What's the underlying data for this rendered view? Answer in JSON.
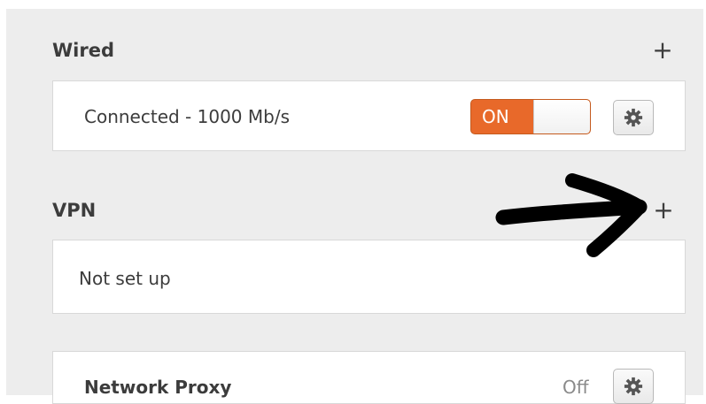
{
  "wired": {
    "title": "Wired",
    "add_symbol": "+",
    "status": "Connected - 1000 Mb/s",
    "toggle_label": "ON",
    "toggle_state": "on"
  },
  "vpn": {
    "title": "VPN",
    "add_symbol": "+",
    "status": "Not set up"
  },
  "proxy": {
    "title": "Network Proxy",
    "status": "Off"
  },
  "colors": {
    "toggle_accent": "#e8692a",
    "panel_background": "#ededed",
    "annotation_arrow": "#000000"
  },
  "icons": {
    "settings": "gear-icon",
    "add": "plus-icon",
    "annotation": "hand-drawn-arrow"
  }
}
